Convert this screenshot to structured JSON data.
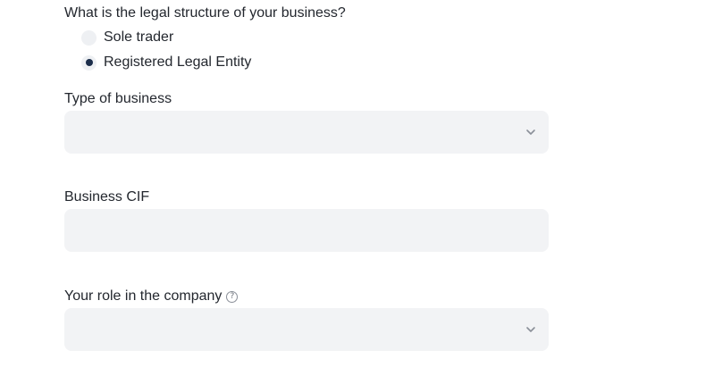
{
  "legal_structure": {
    "question": "What is the legal structure of your business?",
    "options": [
      {
        "label": "Sole trader",
        "selected": false
      },
      {
        "label": "Registered Legal Entity",
        "selected": true
      }
    ]
  },
  "type_of_business": {
    "label": "Type of business",
    "value": "",
    "icon": "chevron-down-icon"
  },
  "business_cif": {
    "label": "Business CIF",
    "value": "",
    "placeholder": ""
  },
  "role_in_company": {
    "label": "Your role in the company",
    "help_icon": "question-circle-icon",
    "value": "",
    "icon": "chevron-down-icon"
  },
  "colors": {
    "field_background": "#f2f3f5",
    "radio_selected": "#1b2d4a",
    "text": "#23272e"
  }
}
